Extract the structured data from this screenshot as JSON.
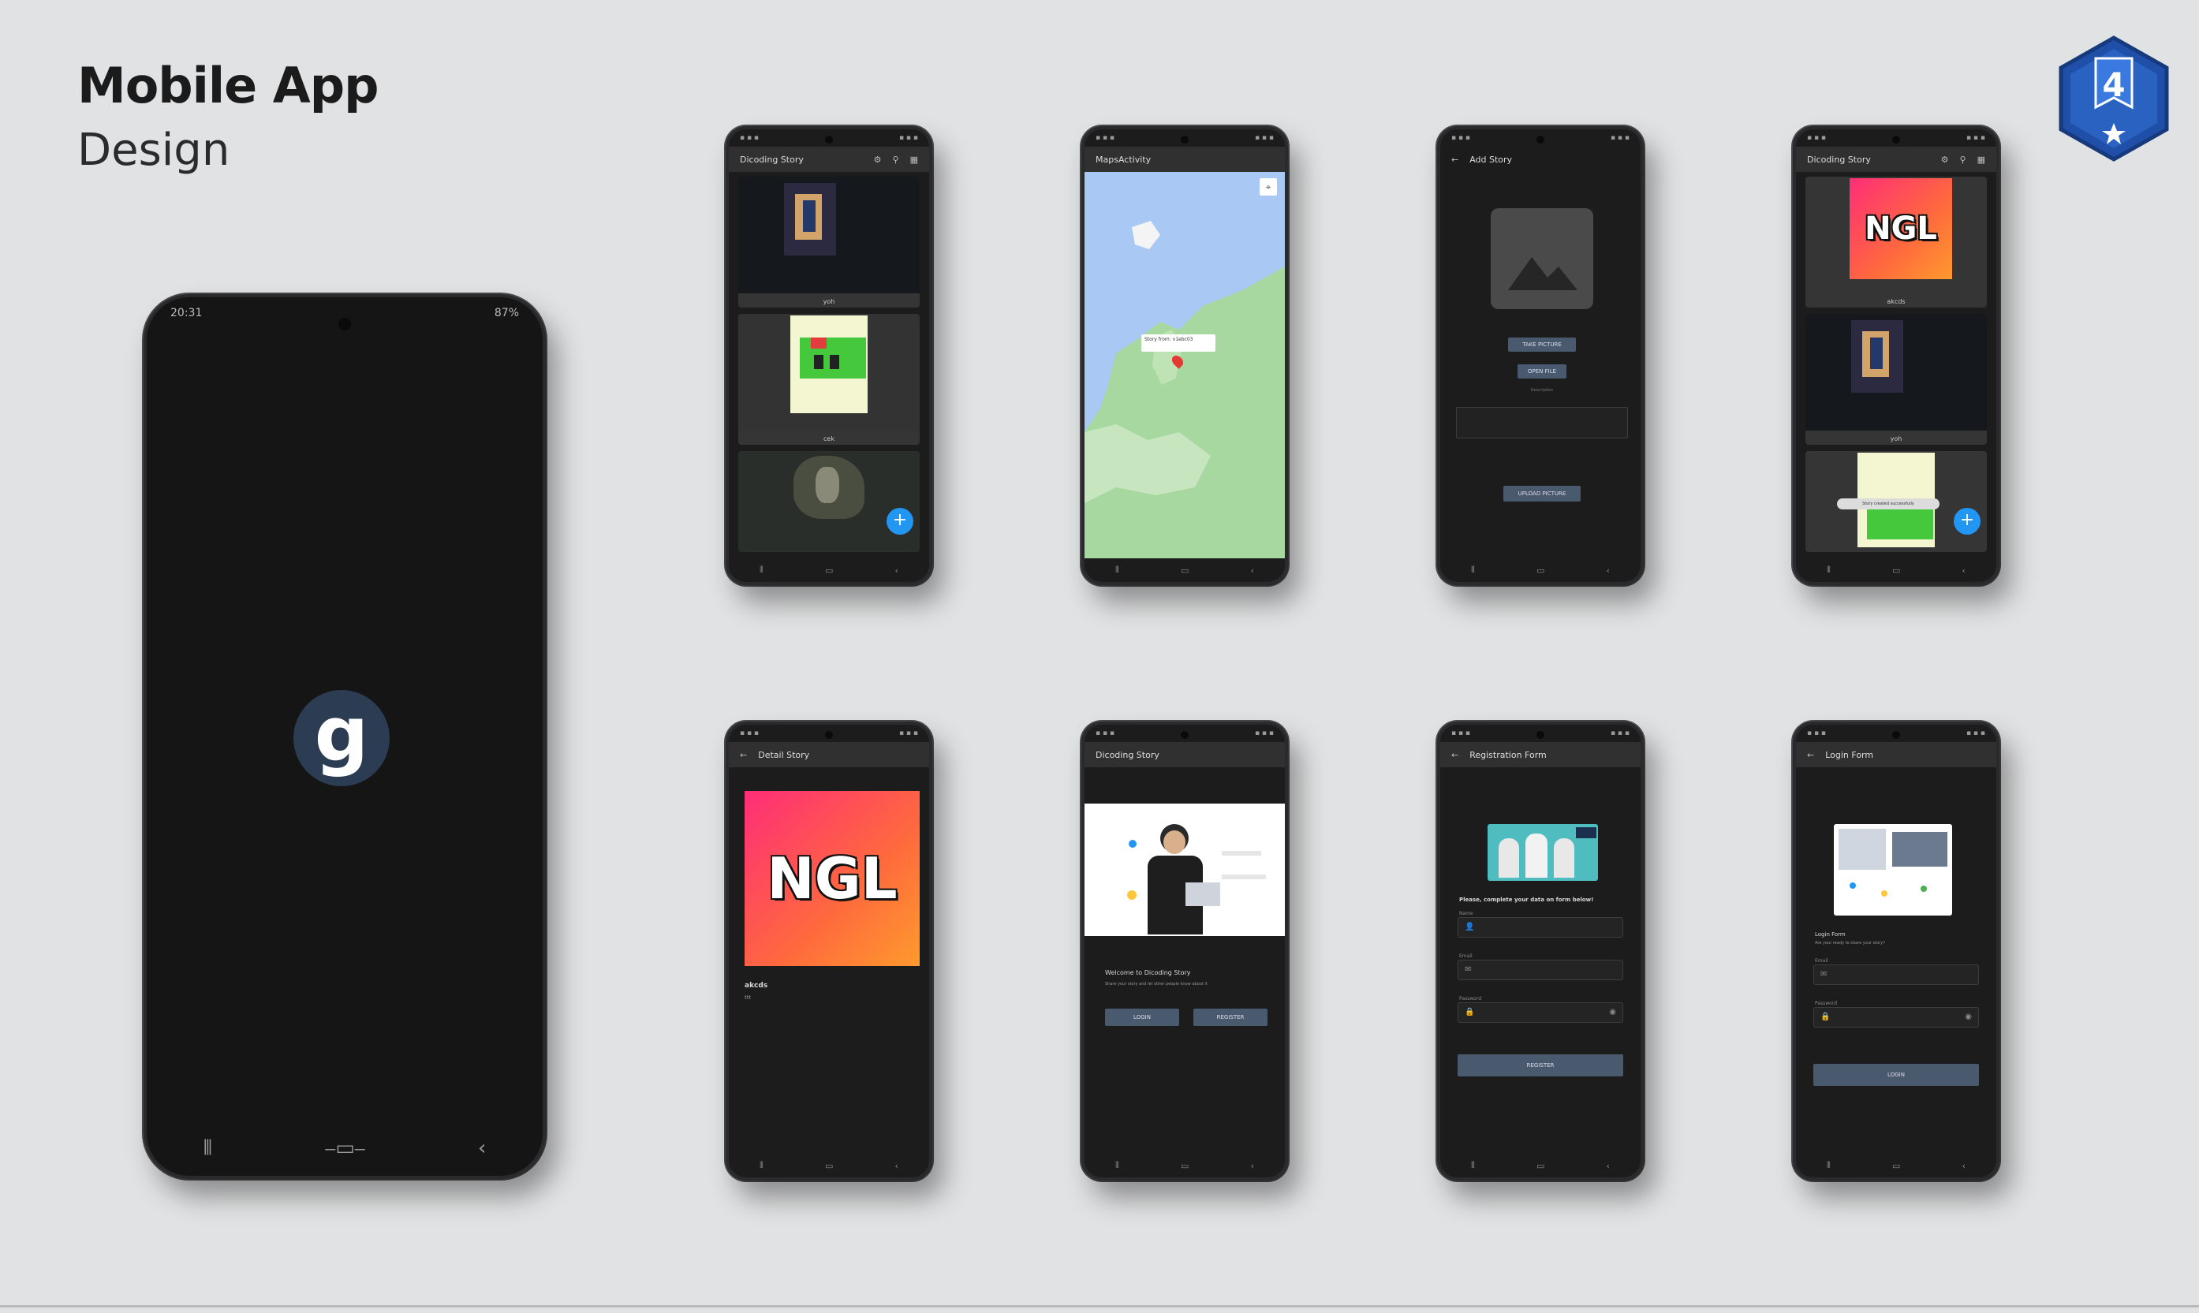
{
  "title": {
    "line1": "Mobile App",
    "line2": "Design"
  },
  "badge": {
    "number": "4"
  },
  "splash": {
    "time": "20:31",
    "status_right": "87%",
    "logo": "g"
  },
  "screens": {
    "list1": {
      "title": "Dicoding Story",
      "captions": [
        "yoh",
        "cek",
        ""
      ]
    },
    "maps": {
      "title": "MapsActivity",
      "pin_label": "Story from: v1ebc03"
    },
    "add": {
      "title": "Add Story",
      "btn_camera": "TAKE PICTURE",
      "btn_gallery": "OPEN FILE",
      "desc_label": "Description",
      "btn_upload": "UPLOAD PICTURE"
    },
    "list2": {
      "title": "Dicoding Story",
      "captions": [
        "akcds",
        "yoh"
      ],
      "toast": "Story created successfully"
    },
    "detail": {
      "title": "Detail Story",
      "name": "akcds",
      "desc": "ttt",
      "ngl": "NGL"
    },
    "welcome": {
      "title": "Dicoding Story",
      "heading": "Welcome to Dicoding Story",
      "sub": "Share your story and let other people know about it",
      "btn_login": "LOGIN",
      "btn_register": "REGISTER"
    },
    "register": {
      "title": "Registration Form",
      "prompt": "Please, complete your data on form below!",
      "labels": [
        "Name",
        "Email",
        "Password"
      ],
      "btn": "REGISTER"
    },
    "login": {
      "title": "Login Form",
      "heading": "Login Form",
      "sub": "Are your ready to share your story?",
      "labels": [
        "Email",
        "Password"
      ],
      "btn": "LOGIN"
    }
  },
  "icons": [
    "back-arrow-icon",
    "settings-icon",
    "location-icon",
    "grid-icon",
    "add-icon",
    "image-placeholder-icon",
    "person-icon",
    "email-icon",
    "lock-icon",
    "eye-icon",
    "recents-icon",
    "home-icon",
    "back-nav-icon"
  ],
  "colors": {
    "background": "#e1e2e3",
    "phone": "#1c1c1d",
    "fab": "#2196f3",
    "badge": "#1f4fa8",
    "button": "#4a5a6e"
  }
}
